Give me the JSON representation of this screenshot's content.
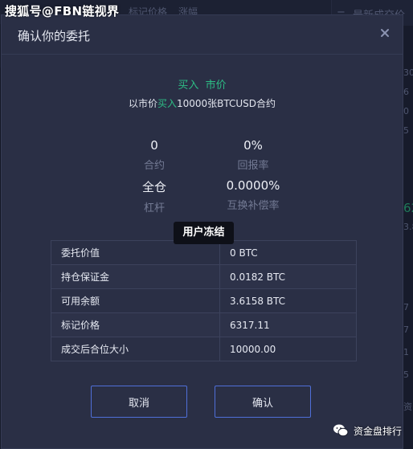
{
  "background": {
    "tabs": [
      "标记价格",
      "涨幅"
    ],
    "right_panel_title": "最新成交价",
    "right_numbers": [
      "30",
      "6",
      "0",
      "5",
      "62",
      "3.8",
      "7",
      "7",
      "1",
      "5"
    ],
    "bottom_label": "资"
  },
  "watermarks": {
    "top_left": "搜狐号@FBN链视界",
    "bottom_right": "资金盘排行"
  },
  "dialog": {
    "title": "确认你的委托",
    "close_icon": "close-icon",
    "order_side": "买入",
    "order_type": "市价",
    "description": {
      "prefix": "以市价",
      "side": "买入",
      "suffix": "10000张BTCUSD合约"
    },
    "stats": [
      {
        "value": "0",
        "label": "合约"
      },
      {
        "value": "0%",
        "label": "回报率"
      },
      {
        "value": "全仓",
        "label": "杠杆"
      },
      {
        "value": "0.0000%",
        "label": "互换补偿率"
      }
    ],
    "tooltip": "用户冻结",
    "details": [
      {
        "key": "委托价值",
        "value": "0 BTC"
      },
      {
        "key": "持仓保证金",
        "value": "0.0182 BTC"
      },
      {
        "key": "可用余额",
        "value": "3.6158 BTC"
      },
      {
        "key": "标记价格",
        "value": "6317.11"
      },
      {
        "key": "成交后合位大小",
        "value": "10000.00"
      }
    ],
    "buttons": {
      "cancel": "取消",
      "confirm": "确认"
    }
  },
  "colors": {
    "buy_green": "#2dbd85",
    "button_border": "#4f6fd8",
    "dialog_bg": "#2a2f45"
  }
}
